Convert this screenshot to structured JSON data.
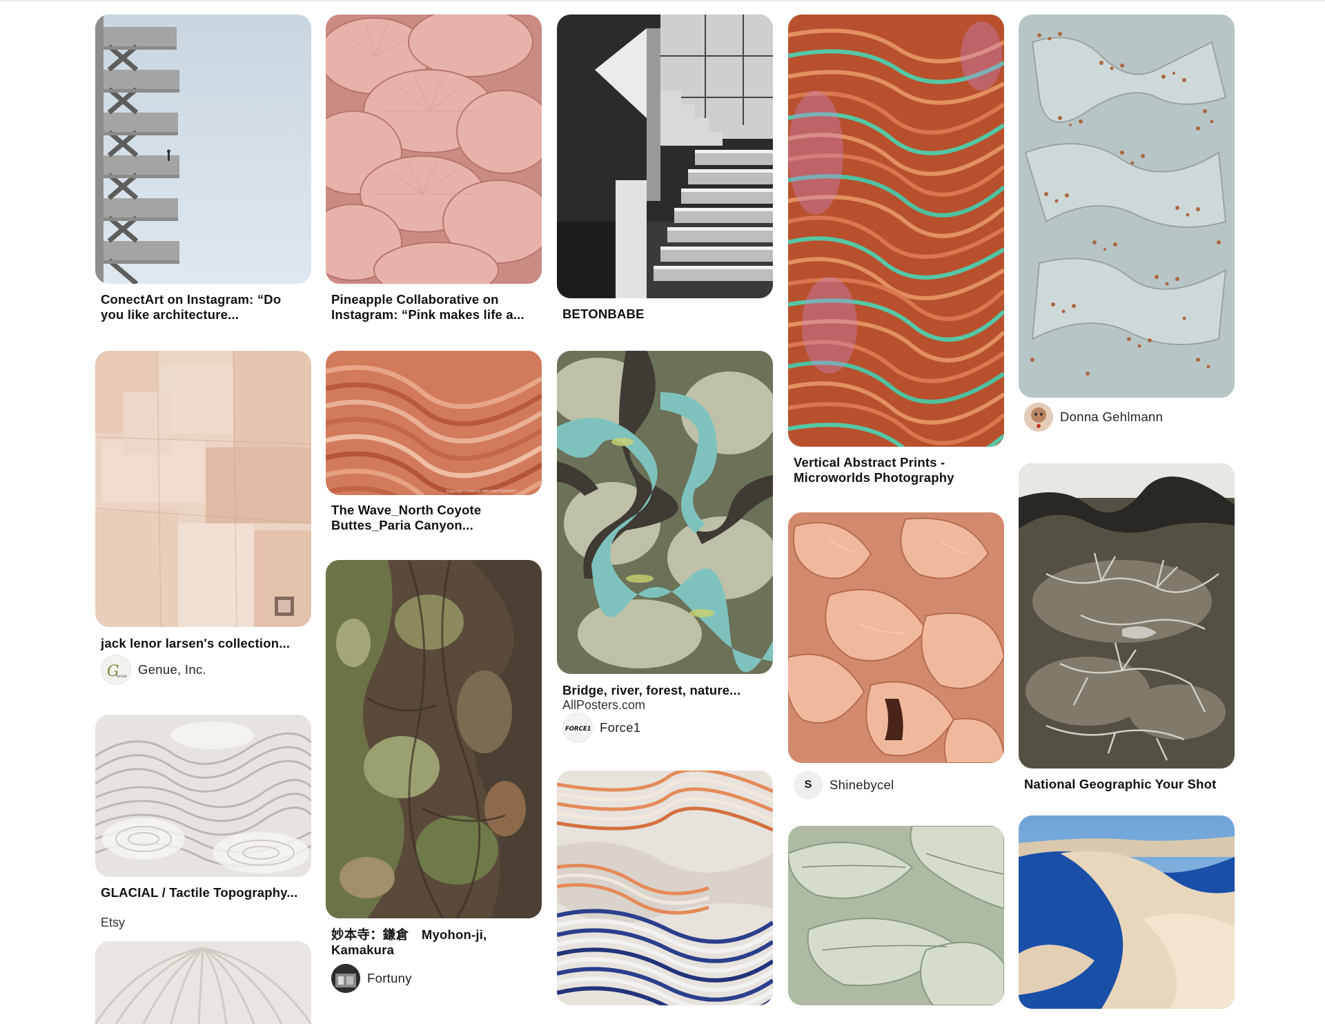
{
  "pins": {
    "conectart": {
      "title": "ConectArt on Instagram: “Do you like architecture...",
      "image_alt": "white stair tower against pale sky"
    },
    "pineapple": {
      "title": "Pineapple Collaborative on Instagram: “Pink makes life a...",
      "image_alt": "pink oyster mushrooms"
    },
    "betonbabe": {
      "title": "BETONBABE",
      "image_alt": "black and white concrete staircase"
    },
    "vertical_abstract": {
      "title": "Vertical Abstract Prints - Microworlds Photography",
      "image_alt": "orange and green coral macro"
    },
    "donna": {
      "image_alt": "rusted metal surface texture",
      "attribution": "Donna Gehlmann"
    },
    "jack_lenor": {
      "title": "jack lenor larsen's collection...",
      "image_alt": "patchwork linen textile",
      "attribution": "Genue, Inc."
    },
    "the_wave": {
      "title": "The Wave_North Coyote Buttes_Paria Canyon...",
      "image_alt": "striped red sandstone wave",
      "image_credit": "Copyright CHARLES ANN PHOTOGRAPHY"
    },
    "bridge_river": {
      "title": "Bridge, river, forest, nature...",
      "source": "AllPosters.com",
      "image_alt": "aerial view of meandering river",
      "attribution": "Force1",
      "attribution_logo_text": "FORCE1"
    },
    "myohonji": {
      "title": "妙本寺：鎌倉　Myohon-ji, Kamakura",
      "image_alt": "tree bark with moss",
      "attribution": "Fortuny"
    },
    "shinebycel": {
      "image_alt": "peach gladiolus petals",
      "attribution": "Shinebycel",
      "avatar_letter": "S"
    },
    "natgeo": {
      "title": "National Geographic Your Shot",
      "image_alt": "aerial view of dendritic salt flats"
    },
    "glacial": {
      "title": "GLACIAL / Tactile Topography...",
      "source": "Etsy",
      "image_alt": "white tactile topography relief"
    },
    "stripes": {
      "image_alt": "striped orange blue ribbon sculpture"
    },
    "sage_leaves": {
      "image_alt": "sage green folded leaves"
    },
    "dunes": {
      "image_alt": "sand dunes under blue sky"
    },
    "white_gills": {
      "image_alt": "white mushroom gills"
    }
  },
  "colors": {
    "title_text": "#111111",
    "subtitle_text": "#333333",
    "background": "#ffffff"
  }
}
